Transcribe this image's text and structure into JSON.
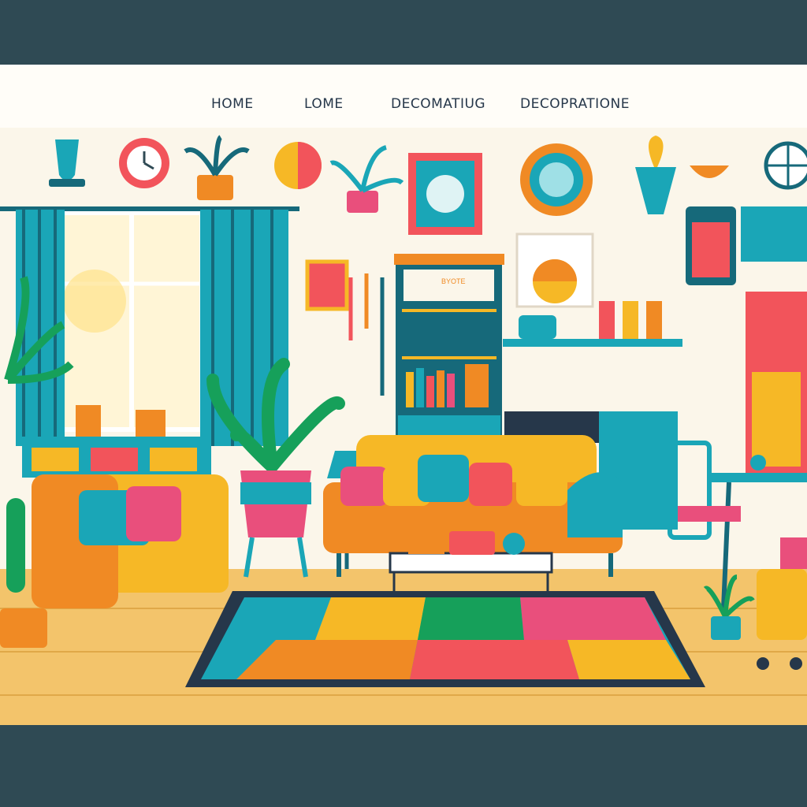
{
  "nav": {
    "items": [
      {
        "label": "HOME"
      },
      {
        "label": "LOME"
      },
      {
        "label": "DECOMATIUG"
      },
      {
        "label": "DECOPRATIONE"
      }
    ]
  },
  "colors": {
    "outer_bg": "#2f4a54",
    "page_bg": "#fdfaf3",
    "teal": "#1aa6b7",
    "dark_teal": "#16697a",
    "mustard": "#f6b826",
    "orange": "#f08a24",
    "coral": "#f2545b",
    "pink": "#e94f7c",
    "floor": "#f3c46b"
  },
  "scene": {
    "bookshelf_label": "BYOTE",
    "icons": [
      "wall-clock-icon",
      "window-icon",
      "curtain-icon",
      "sofa-icon",
      "armchair-icon",
      "potted-plant-icon",
      "floor-lamp-icon",
      "bookshelf-icon",
      "framed-art-icon",
      "mirror-icon",
      "coffee-table-icon",
      "rug-icon",
      "dining-table-icon",
      "kitchen-shelf-icon"
    ]
  }
}
